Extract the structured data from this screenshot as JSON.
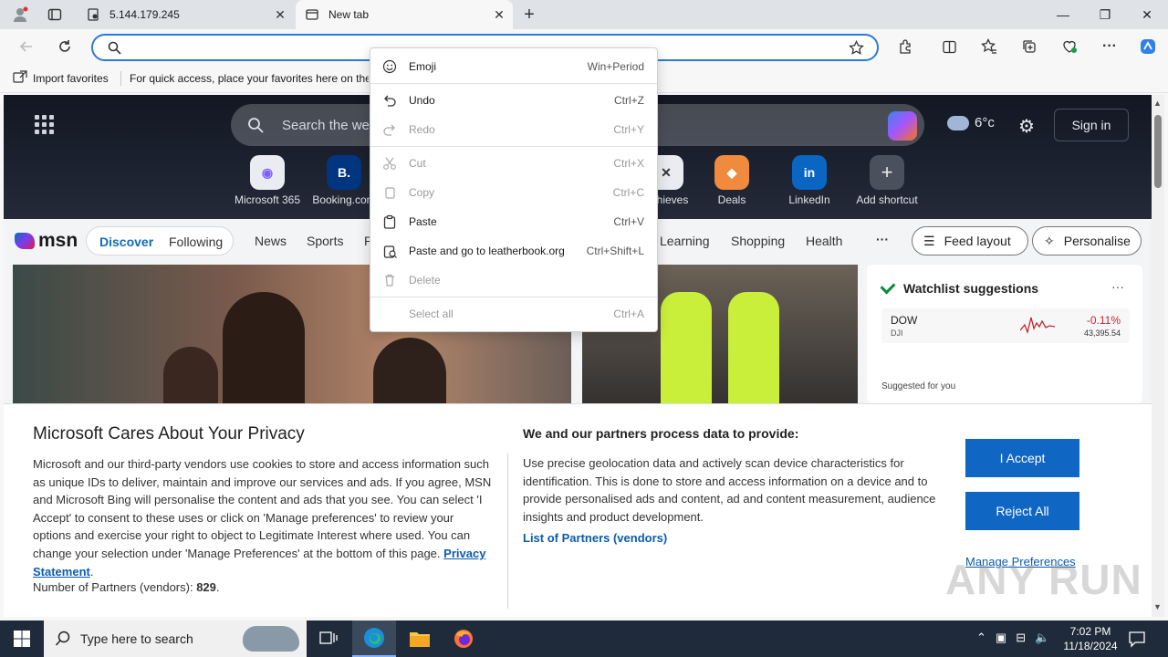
{
  "browser": {
    "tabs": [
      {
        "title": "5.144.179.245",
        "active": false
      },
      {
        "title": "New tab",
        "active": true
      }
    ],
    "new_tab_symbol": "+",
    "window_controls": {
      "minimize": "—",
      "restore": "❐",
      "close": "✕"
    },
    "address": {
      "value": "",
      "placeholder": ""
    },
    "favorites_bar": {
      "import_label": "Import favorites",
      "hint": "For quick access, place your favorites here on the favorites bar."
    }
  },
  "context_menu": {
    "items": [
      {
        "label": "Emoji",
        "shortcut": "Win+Period",
        "enabled": true,
        "icon": "emoji-icon"
      },
      {
        "label": "Undo",
        "shortcut": "Ctrl+Z",
        "enabled": true,
        "icon": "undo-icon"
      },
      {
        "label": "Redo",
        "shortcut": "Ctrl+Y",
        "enabled": false,
        "icon": "redo-icon"
      },
      {
        "label": "Cut",
        "shortcut": "Ctrl+X",
        "enabled": false,
        "icon": "cut-icon"
      },
      {
        "label": "Copy",
        "shortcut": "Ctrl+C",
        "enabled": false,
        "icon": "copy-icon"
      },
      {
        "label": "Paste",
        "shortcut": "Ctrl+V",
        "enabled": true,
        "icon": "paste-icon"
      },
      {
        "label": "Paste and go to leatherbook.org",
        "shortcut": "Ctrl+Shift+L",
        "enabled": true,
        "icon": "paste-go-icon"
      },
      {
        "label": "Delete",
        "shortcut": "",
        "enabled": false,
        "icon": "delete-icon"
      },
      {
        "label": "Select all",
        "shortcut": "Ctrl+A",
        "enabled": false,
        "icon": ""
      }
    ]
  },
  "newtab": {
    "search_placeholder": "Search the web",
    "weather": "6°c",
    "sign_in": "Sign in",
    "shortcuts": [
      {
        "label": "Microsoft 365",
        "glyph": "◉"
      },
      {
        "label": "Booking.com",
        "glyph": "B."
      },
      {
        "label": "Achieves",
        "glyph": "✕"
      },
      {
        "label": "Deals",
        "glyph": "◆"
      },
      {
        "label": "LinkedIn",
        "glyph": "in"
      },
      {
        "label": "Add shortcut",
        "glyph": "+"
      }
    ],
    "msn_logo": "msn",
    "discover": "Discover",
    "following": "Following",
    "nav_links": [
      "News",
      "Sports",
      "P",
      "Learning",
      "Shopping",
      "Health"
    ],
    "more": "···",
    "feed_layout": "Feed layout",
    "personalise": "Personalise",
    "watchlist": {
      "title": "Watchlist suggestions",
      "symbol": "DOW",
      "sub": "DJI",
      "change": "-0.11%",
      "price": "43,395.54",
      "suggested": "Suggested for you"
    }
  },
  "privacy": {
    "title": "Microsoft Cares About Your Privacy",
    "body": "Microsoft and our third-party vendors use cookies to store and access information such as unique IDs to deliver, maintain and improve our services and ads. If you agree, MSN and Microsoft Bing will personalise the content and ads that you see. You can select 'I Accept' to consent to these uses or click on 'Manage preferences' to review your options and exercise your right to object to Legitimate Interest where used.  You can change your selection under 'Manage Preferences' at the bottom of this page.",
    "privacy_link": "Privacy Statement",
    "vendors_label": "Number of Partners (vendors):",
    "vendors_count": "829",
    "right_title": "We and our partners process data to provide:",
    "right_body": "Use precise geolocation data and actively scan device characteristics for identification. This is done to store and access information on a device and to provide personalised ads and content, ad and content measurement, audience insights and product development.",
    "partners_link": "List of Partners (vendors)",
    "accept": "I Accept",
    "reject": "Reject All",
    "manage": "Manage Preferences"
  },
  "watermark": "ANY RUN",
  "taskbar": {
    "search_placeholder": "Type here to search",
    "time": "7:02 PM",
    "date": "11/18/2024"
  },
  "colors": {
    "accent": "#1066c3",
    "link": "#0a5cad",
    "address_focus": "#2d7ad6"
  }
}
